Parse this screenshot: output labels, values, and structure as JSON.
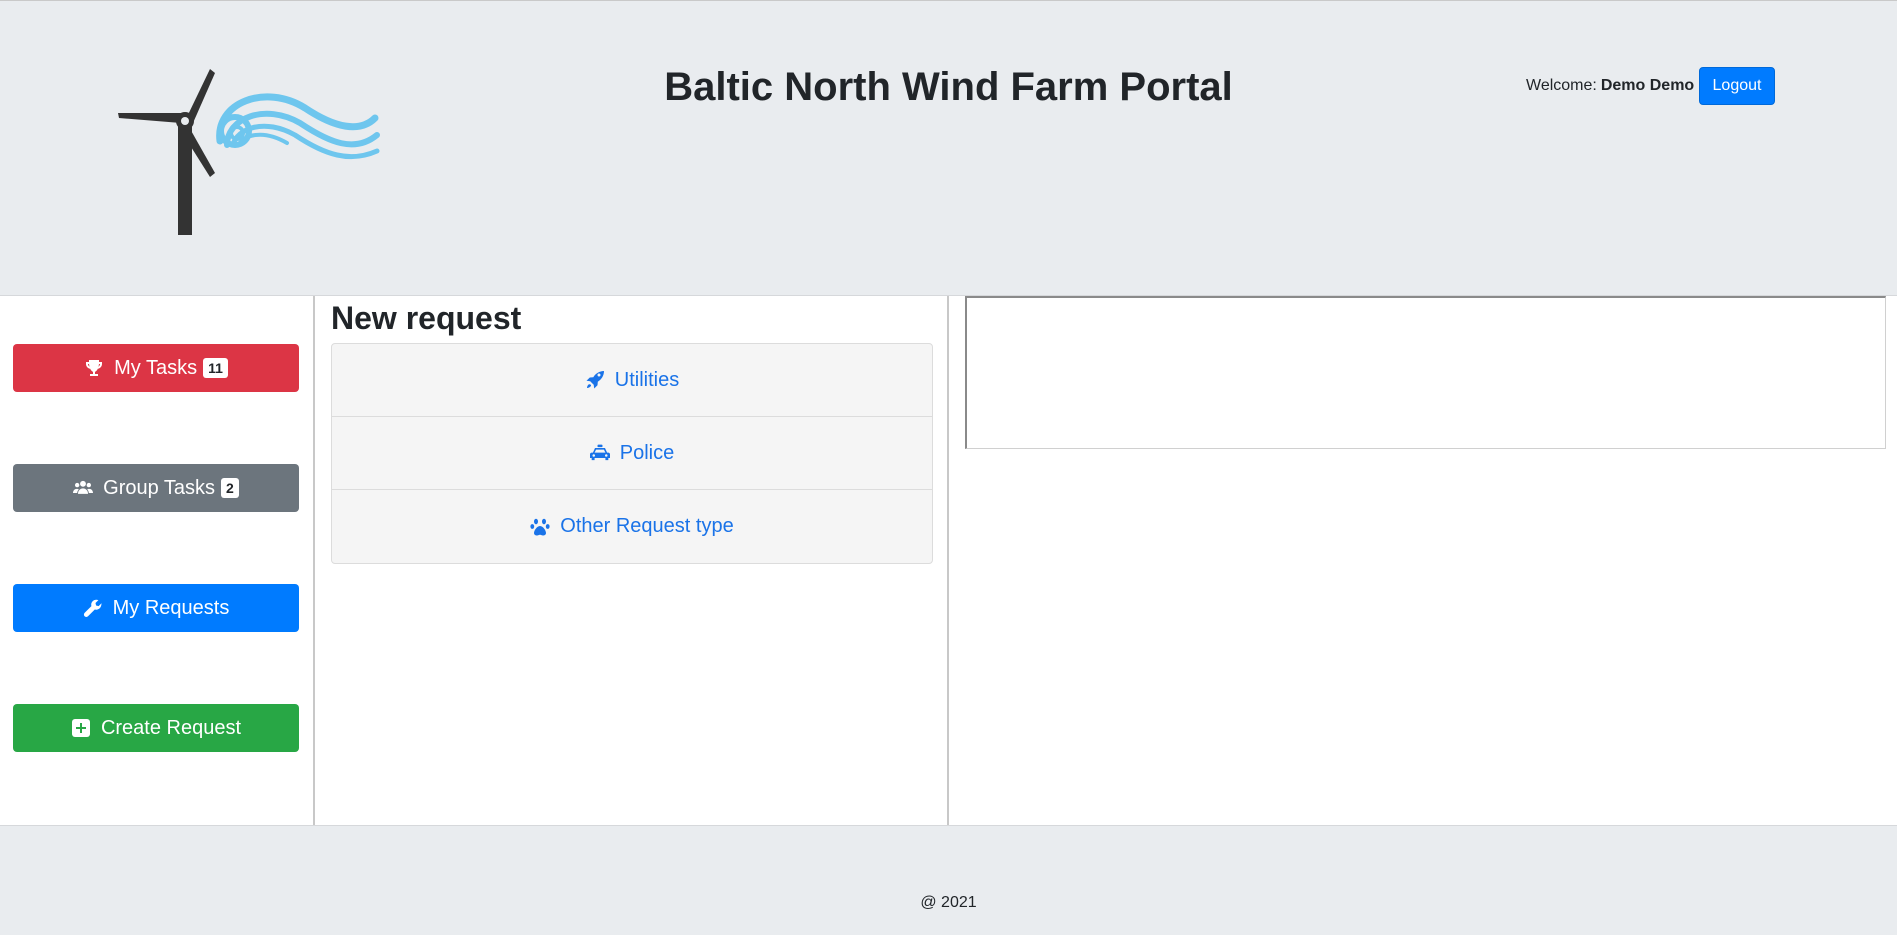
{
  "header": {
    "title": "Baltic North Wind Farm Portal",
    "welcome_label": "Welcome:",
    "user_name": "Demo Demo",
    "logout_label": "Logout",
    "logo_icon": "wind-turbine-logo"
  },
  "sidebar": {
    "items": [
      {
        "label": "My Tasks",
        "badge": "11",
        "icon": "trophy-icon",
        "color": "#dc3545"
      },
      {
        "label": "Group Tasks",
        "badge": "2",
        "icon": "users-icon",
        "color": "#6c757d"
      },
      {
        "label": "My Requests",
        "icon": "wrench-icon",
        "color": "#007bff"
      },
      {
        "label": "Create Request",
        "icon": "plus-square-icon",
        "color": "#28a745"
      }
    ]
  },
  "main": {
    "title": "New request",
    "request_types": [
      {
        "label": "Utilities",
        "icon": "rocket-icon"
      },
      {
        "label": "Police",
        "icon": "car-icon"
      },
      {
        "label": "Other Request type",
        "icon": "paw-icon"
      }
    ],
    "link_color": "#1a73e8"
  },
  "footer": {
    "text": "@ 2021"
  }
}
